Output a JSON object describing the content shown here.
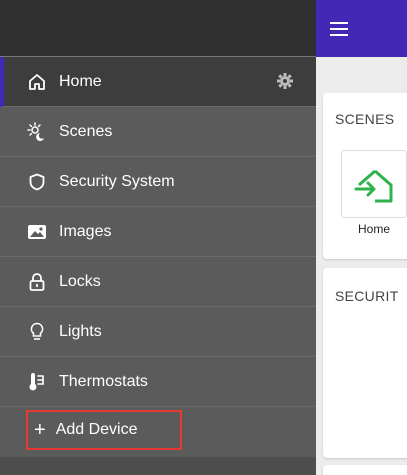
{
  "nav": {
    "items": [
      {
        "label": "Home"
      },
      {
        "label": "Scenes"
      },
      {
        "label": "Security System"
      },
      {
        "label": "Images"
      },
      {
        "label": "Locks"
      },
      {
        "label": "Lights"
      },
      {
        "label": "Thermostats"
      }
    ],
    "add_device": {
      "label": "Add Device"
    }
  },
  "main": {
    "scenes_title": "SCENES",
    "scene_tile_label": "Home",
    "security_title": "SECURIT"
  },
  "colors": {
    "accent": "#4328b5",
    "drawer": "#5b5b5b",
    "highlight": "#e53935",
    "scene_icon": "#2eb34a"
  },
  "icons": {
    "menu": "hamburger-icon",
    "home": "home-icon",
    "settings": "gear-icon",
    "scenes": "scenes-icon",
    "security": "shield-icon",
    "images": "image-icon",
    "locks": "lock-icon",
    "lights": "bulb-icon",
    "thermostats": "thermostat-icon",
    "add": "plus-icon",
    "scene_home": "home-arrow-icon"
  }
}
